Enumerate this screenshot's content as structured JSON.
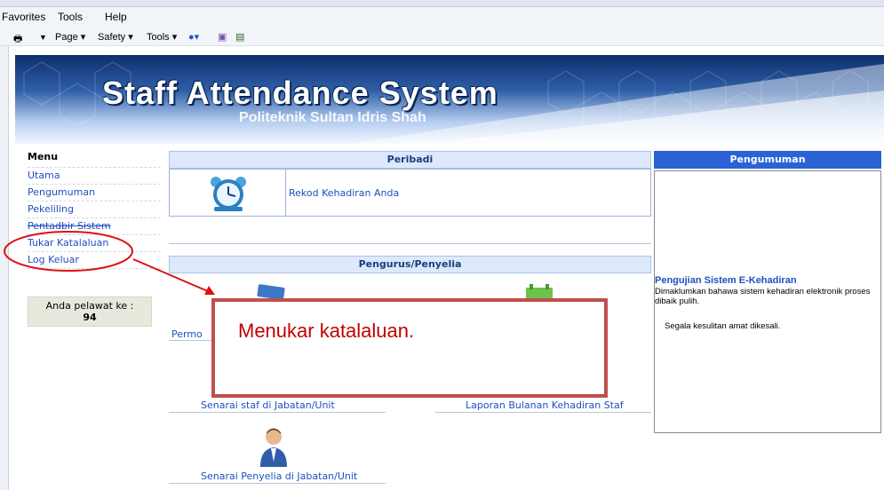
{
  "browser": {
    "menu": [
      "Favorites",
      "Tools",
      "Help"
    ],
    "commands": [
      "Page ▾",
      "Safety ▾",
      "Tools ▾"
    ]
  },
  "banner": {
    "title": "Staff Attendance System",
    "subtitle": "Politeknik Sultan Idris Shah"
  },
  "menu": {
    "heading": "Menu",
    "items": [
      "Utama",
      "Pengumuman",
      "Pekeliling",
      "Pentadbir Sistem",
      "Tukar Katalaluan",
      "Log Keluar"
    ]
  },
  "visitor": {
    "label": "Anda pelawat ke :",
    "count": "94"
  },
  "peribadi": {
    "heading": "Peribadi",
    "link": "Rekod Kehadiran Anda"
  },
  "pengurus": {
    "heading": "Pengurus/Penyelia",
    "links": [
      "Permo",
      "Senarai staf di Jabatan/Unit",
      "Laporan Bulanan Kehadiran Staf",
      "Senarai Penyelia di Jabatan/Unit"
    ]
  },
  "announcement": {
    "heading": "Pengumuman",
    "title": "Pengujian Sistem E-Kehadiran",
    "body": "Dimaklumkan bahawa sistem kehadiran elektronik proses dibaik pulih.",
    "body2": "Segala kesulitan amat dikesali."
  },
  "callout": {
    "text": "Menukar katalaluan."
  },
  "colors": {
    "accent": "#2b63d6",
    "annotation": "#c0504d",
    "link": "#1f4fbf"
  }
}
